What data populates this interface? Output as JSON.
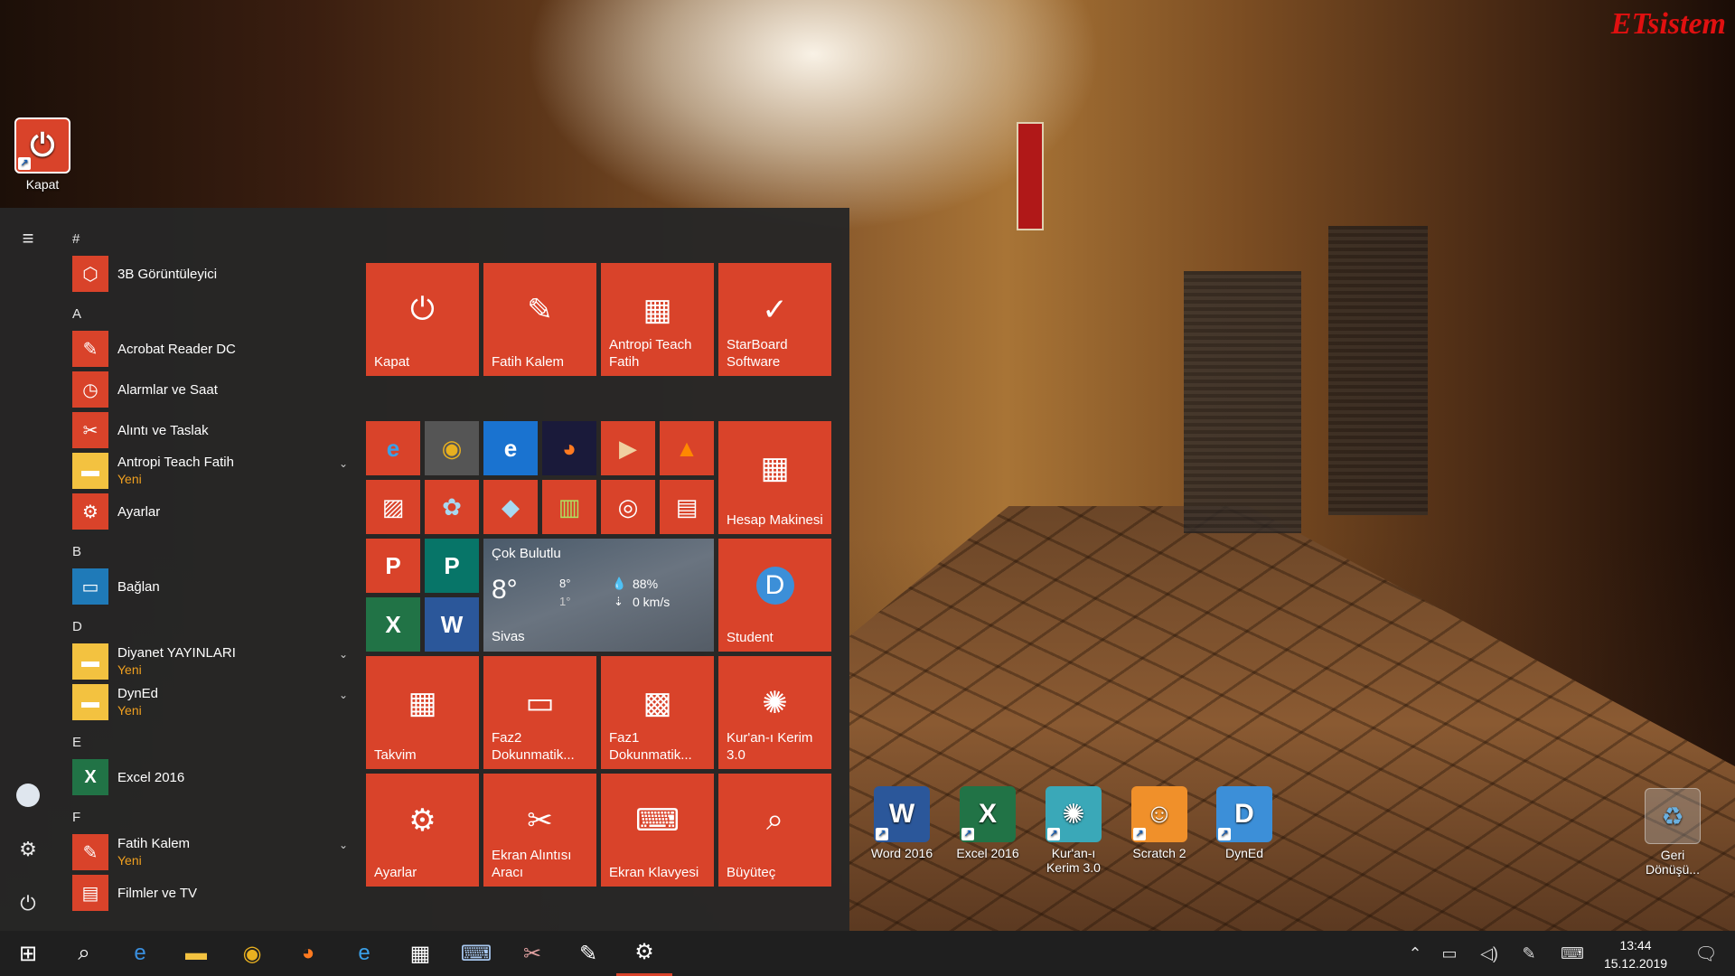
{
  "brand": "ETsistem",
  "desktop": {
    "top_icon": {
      "label": "Kapat",
      "icon": "power-icon"
    },
    "icons": [
      {
        "label": "Word 2016",
        "icon": "word-icon",
        "color": "#2b579a",
        "glyph": "W"
      },
      {
        "label": "Excel 2016",
        "icon": "excel-icon",
        "color": "#217346",
        "glyph": "X"
      },
      {
        "label": "Kur'an-ı Kerim 3.0",
        "icon": "quran-icon",
        "color": "#3aa8b8",
        "glyph": "✺"
      },
      {
        "label": "Scratch 2",
        "icon": "scratch-icon",
        "color": "#f0902a",
        "glyph": "☺"
      },
      {
        "label": "DynEd",
        "icon": "dyned-icon",
        "color": "#3c8fd8",
        "glyph": "D"
      }
    ],
    "recycle_bin": {
      "label": "Geri Dönüşü...",
      "icon": "recycle-bin-icon"
    }
  },
  "start_menu": {
    "rail": {
      "menu": "hamburger-icon",
      "user": "user-avatar",
      "settings": "settings-icon",
      "power": "power-icon"
    },
    "sections": [
      {
        "letter": "#",
        "apps": [
          {
            "name": "3B Görüntüleyici",
            "new": "",
            "icon": "cube-icon",
            "glyph": "⬡",
            "color": "#d9432a"
          }
        ]
      },
      {
        "letter": "A",
        "apps": [
          {
            "name": "Acrobat Reader DC",
            "new": "",
            "icon": "acrobat-icon",
            "glyph": "✎",
            "color": "#d9432a"
          },
          {
            "name": "Alarmlar ve Saat",
            "new": "",
            "icon": "alarm-icon",
            "glyph": "◷",
            "color": "#d9432a"
          },
          {
            "name": "Alıntı ve Taslak",
            "new": "",
            "icon": "snip-icon",
            "glyph": "✂",
            "color": "#d9432a"
          },
          {
            "name": "Antropi Teach Fatih",
            "new": "Yeni",
            "icon": "folder-icon",
            "glyph": "▬",
            "color": "#f3c240"
          },
          {
            "name": "Ayarlar",
            "new": "",
            "icon": "gear-icon",
            "glyph": "⚙",
            "color": "#d9432a"
          }
        ]
      },
      {
        "letter": "B",
        "apps": [
          {
            "name": "Bağlan",
            "new": "",
            "icon": "connect-icon",
            "glyph": "▭",
            "color": "#1f7ab8"
          }
        ]
      },
      {
        "letter": "D",
        "apps": [
          {
            "name": "Diyanet YAYINLARI",
            "new": "Yeni",
            "icon": "folder-icon",
            "glyph": "▬",
            "color": "#f3c240"
          },
          {
            "name": "DynEd",
            "new": "Yeni",
            "icon": "folder-icon",
            "glyph": "▬",
            "color": "#f3c240"
          }
        ]
      },
      {
        "letter": "E",
        "apps": [
          {
            "name": "Excel 2016",
            "new": "",
            "icon": "excel-icon",
            "glyph": "X",
            "color": "#217346"
          }
        ]
      },
      {
        "letter": "F",
        "apps": [
          {
            "name": "Fatih Kalem",
            "new": "Yeni",
            "icon": "pen-icon",
            "glyph": "✎",
            "color": "#d9432a"
          },
          {
            "name": "Filmler ve TV",
            "new": "",
            "icon": "film-icon",
            "glyph": "▤",
            "color": "#d9432a"
          }
        ]
      }
    ],
    "tiles_top": [
      {
        "label": "Kapat",
        "icon": "power-icon",
        "glyph": "⏻"
      },
      {
        "label": "Fatih Kalem",
        "icon": "pen-icon",
        "glyph": "✎"
      },
      {
        "label": "Antropi Teach Fatih",
        "icon": "whiteboard-icon",
        "glyph": "▦"
      },
      {
        "label": "StarBoard Software",
        "icon": "starboard-icon",
        "glyph": "✓"
      }
    ],
    "small_tiles": [
      {
        "icon": "ie-icon",
        "glyph": "e",
        "color": "#d9432a",
        "fg": "#3aa0e8"
      },
      {
        "icon": "chrome-icon",
        "glyph": "◉",
        "color": "#555555",
        "fg": "#e8b020"
      },
      {
        "icon": "edge-icon",
        "glyph": "e",
        "color": "#1a73d0",
        "fg": "#ffffff"
      },
      {
        "icon": "firefox-icon",
        "glyph": "◕",
        "color": "#1a1a3a",
        "fg": "#ff7a20"
      },
      {
        "icon": "media-player-icon",
        "glyph": "▶",
        "color": "#d9432a",
        "fg": "#f0d0a0"
      },
      {
        "icon": "vlc-icon",
        "glyph": "▲",
        "color": "#d9432a",
        "fg": "#ff8800"
      },
      {
        "icon": "photos-icon",
        "glyph": "▨",
        "color": "#d9432a",
        "fg": "#ffffff"
      },
      {
        "icon": "paint-icon",
        "glyph": "✿",
        "color": "#d9432a",
        "fg": "#a8d8f0"
      },
      {
        "icon": "paint3d-icon",
        "glyph": "◆",
        "color": "#d9432a",
        "fg": "#a8d8f0"
      },
      {
        "icon": "chart-app-icon",
        "glyph": "▥",
        "color": "#d9432a",
        "fg": "#b0e060"
      },
      {
        "icon": "groove-icon",
        "glyph": "◎",
        "color": "#d9432a",
        "fg": "#ffffff"
      },
      {
        "icon": "movies-icon",
        "glyph": "▤",
        "color": "#d9432a",
        "fg": "#ffffff"
      },
      {
        "icon": "powerpoint-icon",
        "glyph": "P",
        "color": "#d9432a",
        "fg": "#ffffff"
      },
      {
        "icon": "publisher-icon",
        "glyph": "P",
        "color": "#077568",
        "fg": "#ffffff"
      },
      {
        "icon": "excel-icon",
        "glyph": "X",
        "color": "#217346",
        "fg": "#ffffff"
      },
      {
        "icon": "word-icon",
        "glyph": "W",
        "color": "#2b579a",
        "fg": "#ffffff"
      }
    ],
    "calculator_tile": {
      "label": "Hesap Makinesi",
      "icon": "calculator-icon",
      "glyph": "▦"
    },
    "weather": {
      "condition": "Çok Bulutlu",
      "temp": "8°",
      "high": "8°",
      "low": "1°",
      "humidity": "88%",
      "wind": "0 km/s",
      "city": "Sivas"
    },
    "student_tile": {
      "label": "Student",
      "icon": "dyned-icon",
      "glyph": "D"
    },
    "tiles_row3": [
      {
        "label": "Takvim",
        "icon": "calendar-icon",
        "glyph": "▦"
      },
      {
        "label": "Faz2 Dokunmatik...",
        "icon": "monitor-icon",
        "glyph": "▭"
      },
      {
        "label": "Faz1 Dokunmatik...",
        "icon": "windows-board-icon",
        "glyph": "▩"
      },
      {
        "label": "Kur'an-ı Kerim 3.0",
        "icon": "quran-icon",
        "glyph": "✺"
      }
    ],
    "tiles_row4": [
      {
        "label": "Ayarlar",
        "icon": "gear-icon",
        "glyph": "⚙"
      },
      {
        "label": "Ekran Alıntısı Aracı",
        "icon": "snipping-tool-icon",
        "glyph": "✂"
      },
      {
        "label": "Ekran Klavyesi",
        "icon": "keyboard-icon",
        "glyph": "⌨"
      },
      {
        "label": "Büyüteç",
        "icon": "magnifier-icon",
        "glyph": "⌕"
      }
    ]
  },
  "taskbar": {
    "items": [
      {
        "icon": "windows-start-icon",
        "glyph": "⊞",
        "color": "#ffffff"
      },
      {
        "icon": "search-icon",
        "glyph": "⌕",
        "color": "#ffffff"
      },
      {
        "icon": "edge-icon",
        "glyph": "e",
        "color": "#3a90e0"
      },
      {
        "icon": "file-explorer-icon",
        "glyph": "▬",
        "color": "#f3c240"
      },
      {
        "icon": "chrome-icon",
        "glyph": "◉",
        "color": "#e8b020"
      },
      {
        "icon": "firefox-icon",
        "glyph": "◕",
        "color": "#ff7a20"
      },
      {
        "icon": "ie-icon",
        "glyph": "e",
        "color": "#3aa0e8"
      },
      {
        "icon": "calculator-icon",
        "glyph": "▦",
        "color": "#ffffff"
      },
      {
        "icon": "keyboard-icon",
        "glyph": "⌨",
        "color": "#a8c8f0"
      },
      {
        "icon": "snipping-tool-icon",
        "glyph": "✂",
        "color": "#e0a0a0"
      },
      {
        "icon": "pen-icon",
        "glyph": "✎",
        "color": "#ffffff"
      },
      {
        "icon": "settings-icon",
        "glyph": "⚙",
        "color": "#ffffff"
      }
    ],
    "tray": [
      {
        "icon": "chevron-up-icon",
        "glyph": "⌃"
      },
      {
        "icon": "network-icon",
        "glyph": "▭"
      },
      {
        "icon": "volume-icon",
        "glyph": "◁)"
      },
      {
        "icon": "pen-workspace-icon",
        "glyph": "✎"
      },
      {
        "icon": "touch-keyboard-icon",
        "glyph": "⌨"
      }
    ],
    "time": "13:44",
    "date": "15.12.2019",
    "notification": "notification-icon"
  }
}
